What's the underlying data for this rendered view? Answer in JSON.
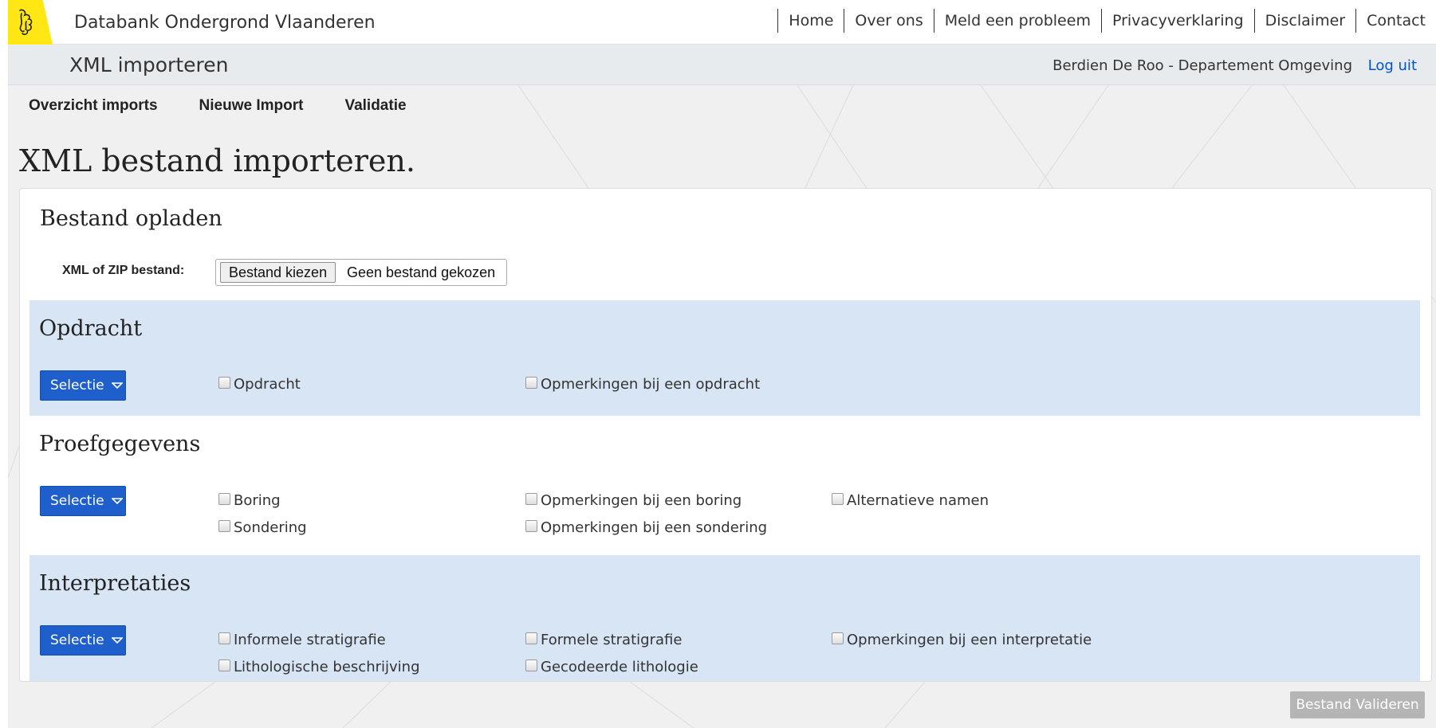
{
  "site": {
    "title": "Databank Ondergrond Vlaanderen",
    "logo": "flemish-lion-icon",
    "brand_color": "#ffe615"
  },
  "topnav": {
    "items": [
      {
        "label": "Home"
      },
      {
        "label": "Over ons"
      },
      {
        "label": "Meld een probleem"
      },
      {
        "label": "Privacyverklaring"
      },
      {
        "label": "Disclaimer"
      },
      {
        "label": "Contact"
      }
    ]
  },
  "subheader": {
    "title": "XML importeren",
    "user": "Berdien De Roo - Departement Omgeving",
    "logout": "Log uit"
  },
  "tabs": [
    {
      "label": "Overzicht imports"
    },
    {
      "label": "Nieuwe Import"
    },
    {
      "label": "Validatie"
    }
  ],
  "page": {
    "heading": "XML bestand importeren."
  },
  "upload": {
    "title": "Bestand opladen",
    "field_label": "XML of ZIP bestand:",
    "button_label": "Bestand kiezen",
    "status": "Geen bestand gekozen"
  },
  "selectie_label": "Selectie",
  "sections": {
    "opdracht": {
      "title": "Opdracht",
      "options": [
        {
          "label": "Opdracht",
          "checked": false
        },
        {
          "label": "Opmerkingen bij een opdracht",
          "checked": false
        }
      ]
    },
    "proefgegevens": {
      "title": "Proefgegevens",
      "options": [
        {
          "label": "Boring",
          "checked": false
        },
        {
          "label": "Opmerkingen bij een boring",
          "checked": false
        },
        {
          "label": "Alternatieve namen",
          "checked": false
        },
        {
          "label": "Sondering",
          "checked": false
        },
        {
          "label": "Opmerkingen bij een sondering",
          "checked": false
        }
      ]
    },
    "interpretaties": {
      "title": "Interpretaties",
      "options": [
        {
          "label": "Informele stratigrafie",
          "checked": false
        },
        {
          "label": "Formele stratigrafie",
          "checked": false
        },
        {
          "label": "Opmerkingen bij een interpretatie",
          "checked": false
        },
        {
          "label": "Lithologische beschrijving",
          "checked": false
        },
        {
          "label": "Gecodeerde lithologie",
          "checked": false
        }
      ]
    }
  },
  "footer": {
    "validate_button": "Bestand Valideren"
  },
  "colors": {
    "primary_button": "#1f5fcc",
    "section_blue": "#d7e5f5",
    "link": "#0055cc",
    "disabled_button": "#b5b5b5"
  }
}
